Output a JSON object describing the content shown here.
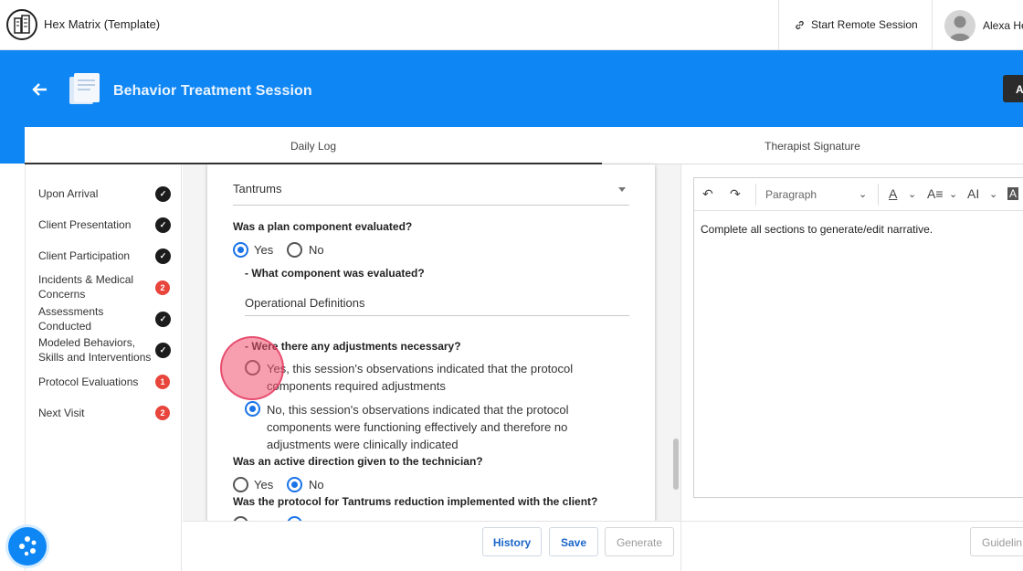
{
  "app": {
    "title": "Hex Matrix (Template)"
  },
  "topbar": {
    "remote_session_label": "Start Remote Session",
    "user_name": "Alexa He"
  },
  "header": {
    "title": "Behavior Treatment Session",
    "action_partial_label": "A"
  },
  "tabs": [
    {
      "label": "Daily Log",
      "active": true
    },
    {
      "label": "Therapist Signature",
      "active": false
    }
  ],
  "sidebar": {
    "items": [
      {
        "label": "Upon Arrival",
        "status": "complete",
        "count": ""
      },
      {
        "label": "Client Presentation",
        "status": "complete",
        "count": ""
      },
      {
        "label": "Client Participation",
        "status": "complete",
        "count": ""
      },
      {
        "label": "Incidents & Medical Concerns",
        "status": "pending",
        "count": "2"
      },
      {
        "label": "Assessments Conducted",
        "status": "complete",
        "count": ""
      },
      {
        "label": "Modeled Behaviors, Skills and Interventions",
        "status": "complete",
        "count": ""
      },
      {
        "label": "Protocol Evaluations",
        "status": "pending",
        "count": "1"
      },
      {
        "label": "Next Visit",
        "status": "pending",
        "count": "2"
      }
    ]
  },
  "form": {
    "behavior_select": "Tantrums",
    "q1": {
      "text": "Was a plan component evaluated?",
      "yes": "Yes",
      "no": "No",
      "selected": "Yes"
    },
    "q1_sub": {
      "text": "- What component was evaluated?",
      "value": "Operational Definitions"
    },
    "q2": {
      "text": "- Were there any adjustments necessary?",
      "opt_yes": "Yes, this session's observations indicated that the protocol components required adjustments",
      "opt_no": "No, this session's observations indicated that the protocol components were functioning effectively and therefore no adjustments were clinically indicated",
      "selected": "No"
    },
    "q3": {
      "text": "Was an active direction given to the technician?",
      "yes": "Yes",
      "no": "No",
      "selected": "No"
    },
    "q4": {
      "text": "Was the protocol for Tantrums reduction implemented with the client?"
    }
  },
  "actions": {
    "history": "History",
    "save": "Save",
    "generate": "Generate",
    "guidelines": "Guidelin"
  },
  "editor": {
    "block_format": "Paragraph",
    "content": "Complete all sections to generate/edit narrative."
  },
  "colors": {
    "brand_blue": "#0e86f4",
    "badge_red": "#e8453c",
    "radio_blue": "#1a73e8"
  }
}
